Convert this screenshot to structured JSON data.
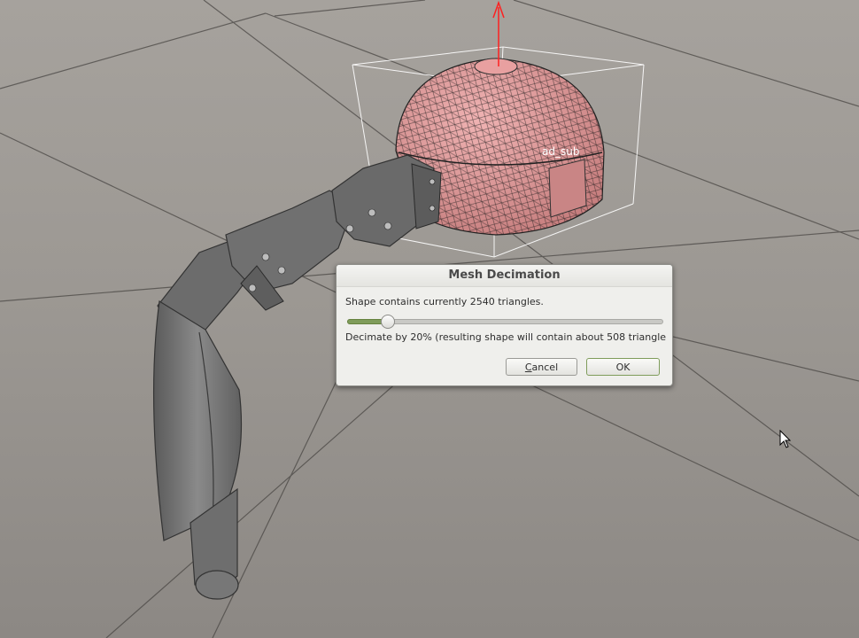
{
  "scene": {
    "object_label": "ad_sub"
  },
  "dialog": {
    "title": "Mesh Decimation",
    "message": "Shape contains currently 2540 triangles.",
    "slider_fraction": 0.13,
    "status": "Decimate by 20% (resulting shape will contain about 508 triangle",
    "cancel_mnemonic": "C",
    "cancel_rest": "ancel",
    "ok_label": "OK"
  },
  "colors": {
    "floor": "#8f8b86",
    "mesh_fill": "#d98c8c",
    "robot_gray": "#6f6f6f",
    "axis_red": "#ff2020",
    "slider_accent": "#7f9c5b"
  }
}
